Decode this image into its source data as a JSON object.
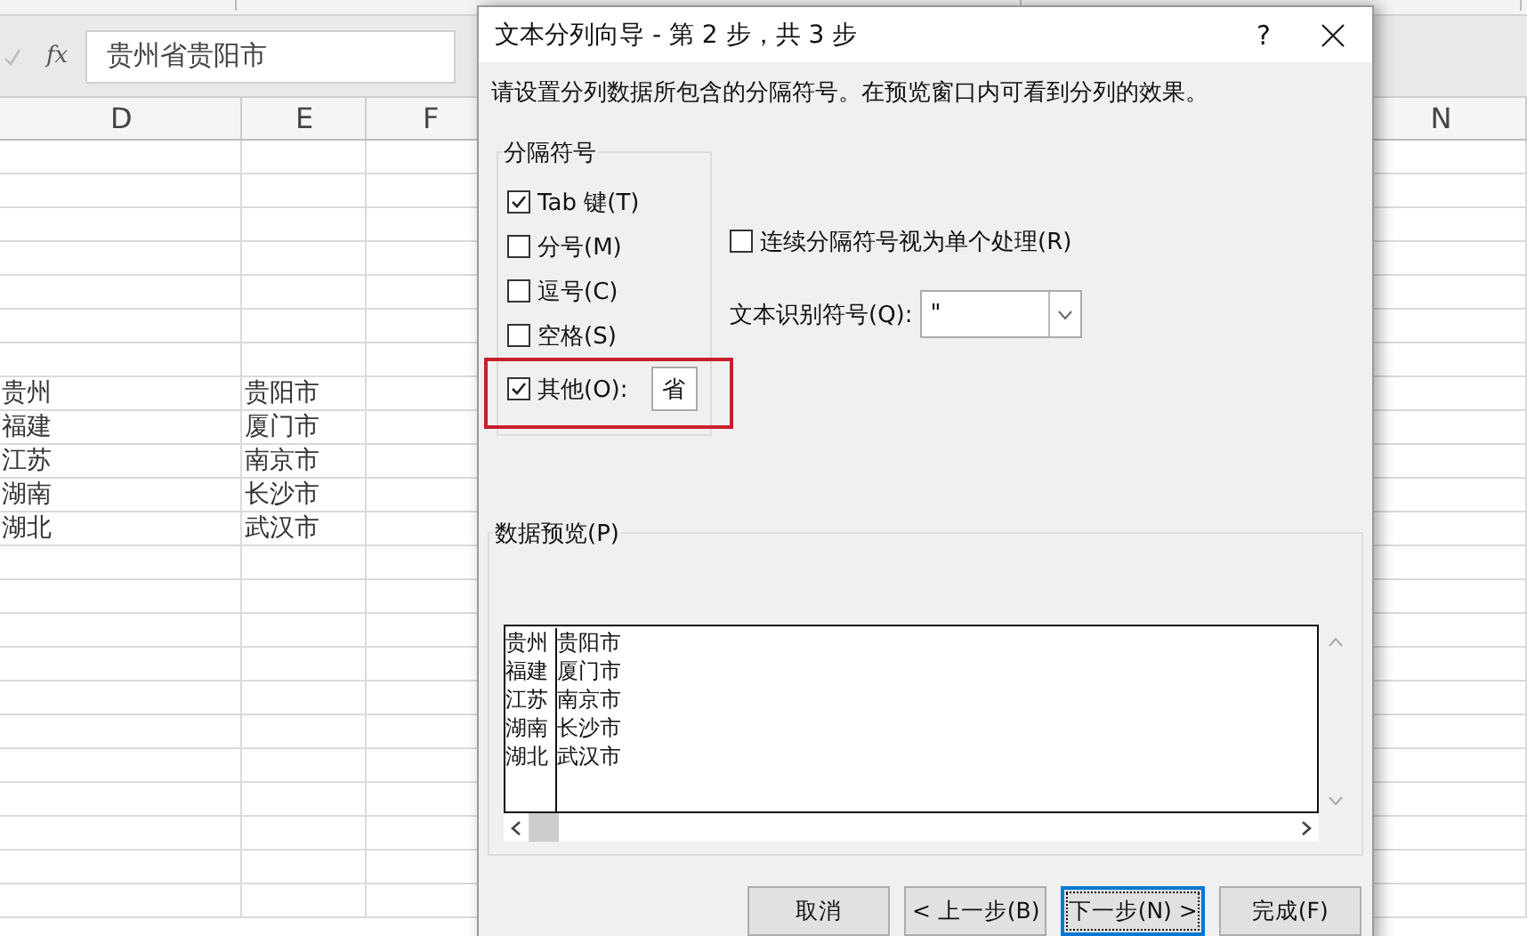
{
  "sheet": {
    "fx": "fx",
    "formula": "贵州省贵阳市",
    "columns": [
      {
        "label": "D"
      },
      {
        "label": "E"
      },
      {
        "label": "F"
      },
      {
        "label": "N"
      }
    ],
    "rows": [
      {
        "d": "贵州",
        "e": "贵阳市"
      },
      {
        "d": "福建",
        "e": "厦门市"
      },
      {
        "d": "江苏",
        "e": "南京市"
      },
      {
        "d": "湖南",
        "e": "长沙市"
      },
      {
        "d": "湖北",
        "e": "武汉市"
      }
    ]
  },
  "dialog": {
    "title": "文本分列向导 - 第 2 步，共 3 步",
    "help": "?",
    "instruction": "请设置分列数据所包含的分隔符号。在预览窗口内可看到分列的效果。",
    "delimiters": {
      "legend": "分隔符号",
      "items": [
        {
          "kind": "checkbox",
          "label": "Tab 键(T)",
          "checked": true,
          "highlighted": false
        },
        {
          "kind": "checkbox",
          "label": "分号(M)",
          "checked": false,
          "highlighted": false
        },
        {
          "kind": "checkbox",
          "label": "逗号(C)",
          "checked": false,
          "highlighted": false
        },
        {
          "kind": "checkbox",
          "label": "空格(S)",
          "checked": false,
          "highlighted": false
        },
        {
          "kind": "checkbox-input",
          "label": "其他(O):",
          "checked": true,
          "highlighted": true,
          "value": "省"
        }
      ]
    },
    "consecutive": {
      "label": "连续分隔符号视为单个处理(R)",
      "checked": false
    },
    "qualifier": {
      "label": "文本识别符号(Q):",
      "value": "\""
    },
    "preview": {
      "legend": "数据预览(P)",
      "rows": [
        [
          "贵州",
          "贵阳市"
        ],
        [
          "福建",
          "厦门市"
        ],
        [
          "江苏",
          "南京市"
        ],
        [
          "湖南",
          "长沙市"
        ],
        [
          "湖北",
          "武汉市"
        ]
      ]
    },
    "buttons": [
      {
        "label": "取消",
        "focused": false
      },
      {
        "label": "< 上一步(B)",
        "focused": false
      },
      {
        "label": "下一步(N) >",
        "focused": true
      },
      {
        "label": "完成(F)",
        "focused": false
      }
    ]
  }
}
